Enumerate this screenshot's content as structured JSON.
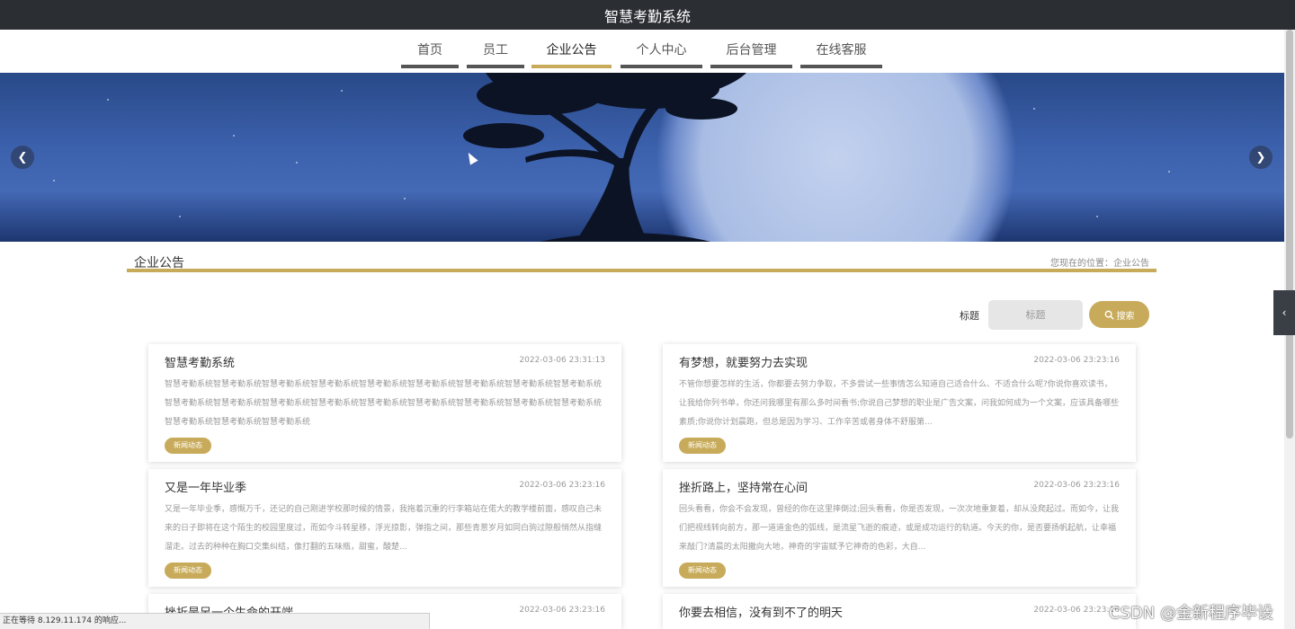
{
  "header": {
    "site_title": "智慧考勤系统"
  },
  "nav": [
    {
      "label": "首页"
    },
    {
      "label": "员工"
    },
    {
      "label": "企业公告"
    },
    {
      "label": "个人中心"
    },
    {
      "label": "后台管理"
    },
    {
      "label": "在线客服"
    }
  ],
  "nav_active": "企业公告",
  "banner": {
    "prev_icon": "chevron-left-icon",
    "next_icon": "chevron-right-icon",
    "prev_glyph": "❮",
    "next_glyph": "❯"
  },
  "section": {
    "title": "企业公告",
    "breadcrumb": "您现在的位置：企业公告"
  },
  "search": {
    "label": "标题",
    "placeholder": "标题",
    "button_label": "搜索",
    "button_icon": "search-icon"
  },
  "side_tab": {
    "icon": "chevron-left-icon",
    "glyph": "‹"
  },
  "cards": [
    {
      "title": "智慧考勤系统",
      "date": "2022-03-06 23:31:13",
      "excerpt": "智慧考勤系统智慧考勤系统智慧考勤系统智慧考勤系统智慧考勤系统智慧考勤系统智慧考勤系统智慧考勤系统智慧考勤系统智慧考勤系统智慧考勤系统智慧考勤系统智慧考勤系统智慧考勤系统智慧考勤系统智慧考勤系统智慧考勤系统智慧考勤系统智慧考勤系统智慧考勤系统智慧考勤系统",
      "tag": "新闻动态"
    },
    {
      "title": "有梦想，就要努力去实现",
      "date": "2022-03-06 23:23:16",
      "excerpt": "不管你想要怎样的生活，你都要去努力争取，不多尝试一些事情怎么知道自己适合什么、不适合什么呢?你说你喜欢读书，让我给你列书单，你还问我哪里有那么多时间看书;你说自己梦想的职业是广告文案，问我如何成为一个文案，应该具备哪些素质;你说你计划晨跑，但总是因为学习、工作辛苦或者身体不舒服第...",
      "tag": "新闻动态"
    },
    {
      "title": "又是一年毕业季",
      "date": "2022-03-06 23:23:16",
      "excerpt": "又是一年毕业季，感慨万千，还记的自己刚进学校那时候的情景，我拖着沉重的行李箱站在偌大的教学楼前面，感叹自己未来的日子即将在这个陌生的校园里度过，而如今斗转星移，浮光掠影，弹指之间，那些青葱岁月如同白驹过隙般悄然从指缝溜走。过去的种种在胸口交集纠结，像打翻的五味瓶，甜蜜，酸楚...",
      "tag": "新闻动态"
    },
    {
      "title": "挫折路上，坚持常在心间",
      "date": "2022-03-06 23:23:16",
      "excerpt": "回头看看，你会不会发现，曾经的你在这里摔倒过;回头看看，你是否发现，一次次地重复着，却从没爬起过。而如今，让我们把视线转向前方，那一道道金色的弧线，是流星飞逝的痕迹，或是成功运行的轨道。今天的你，是否要扬帆起航，让幸福来敲门?清晨的太阳撒向大地，神奇的宇宙赋予它神奇的色彩，大自...",
      "tag": "新闻动态"
    },
    {
      "title": "挫折是另一个生命的开端",
      "date": "2022-03-06 23:23:16",
      "excerpt": "",
      "tag": ""
    },
    {
      "title": "你要去相信，没有到不了的明天",
      "date": "2022-03-06 23:23:16",
      "excerpt": "",
      "tag": ""
    }
  ],
  "status_bar": "正在等待 8.129.11.174 的响应...",
  "watermark": "CSDN @金新程序毕设",
  "colors": {
    "accent": "#c8ab5a",
    "topbar": "#2b2e33",
    "nav_underline": "#555555"
  }
}
